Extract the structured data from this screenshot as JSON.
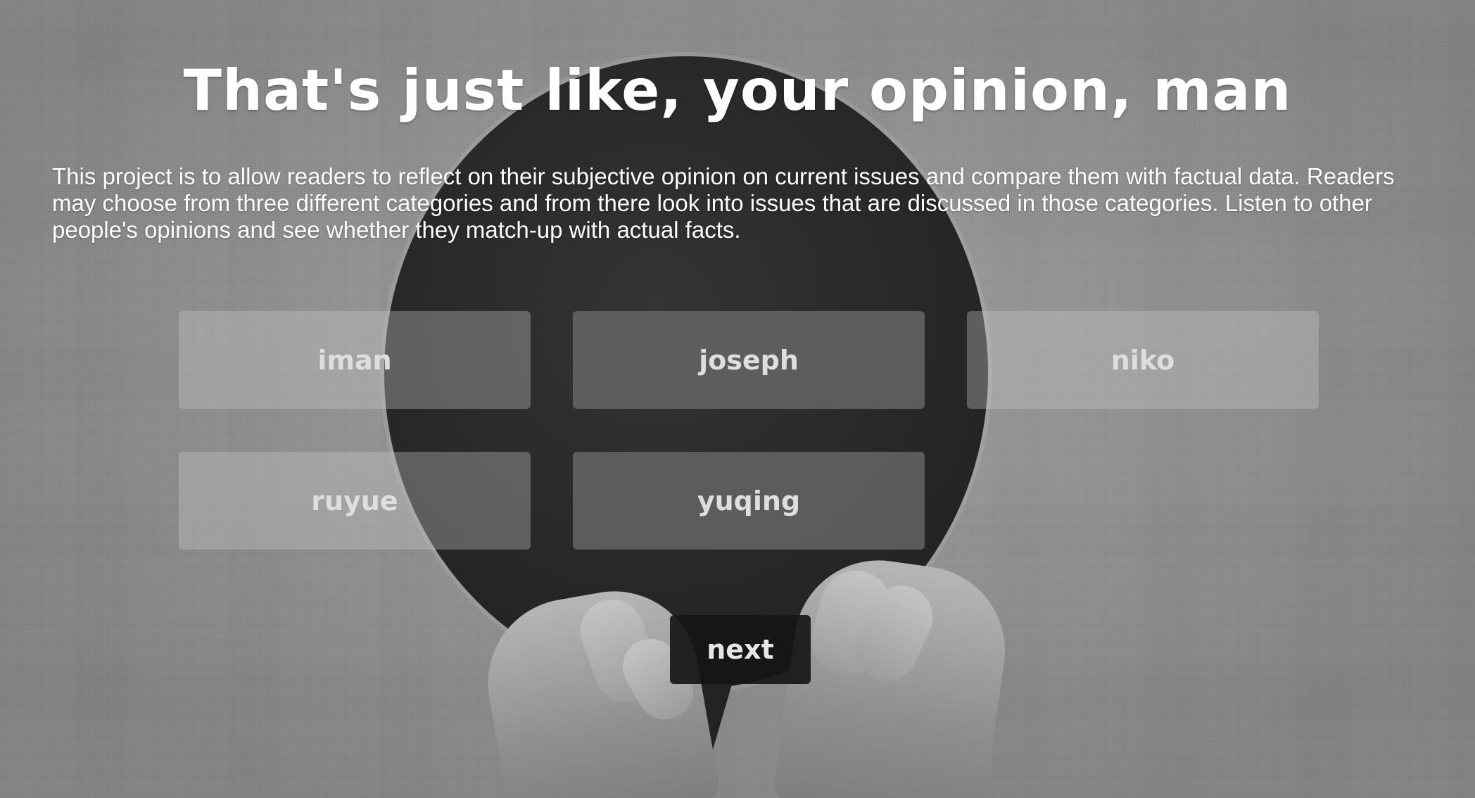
{
  "page": {
    "title": "That's just like, your opinion, man",
    "description": "This project is to allow readers to reflect on their subjective opinion on current issues and compare them with factual data. Readers may choose from three different categories and from there look into issues that are discussed in those categories. Listen to other people's opinions and see whether they match-up with actual facts."
  },
  "people": [
    {
      "label": "iman"
    },
    {
      "label": "joseph"
    },
    {
      "label": "niko"
    },
    {
      "label": "ruyue"
    },
    {
      "label": "yuqing"
    }
  ],
  "actions": {
    "next_label": "next"
  },
  "colors": {
    "background": "#9a9a9a",
    "bubble": "#242424",
    "text": "#ffffff",
    "button_light": "#c8c8c8",
    "button_dark": "#6e6e6e",
    "next_button": "#161616"
  }
}
